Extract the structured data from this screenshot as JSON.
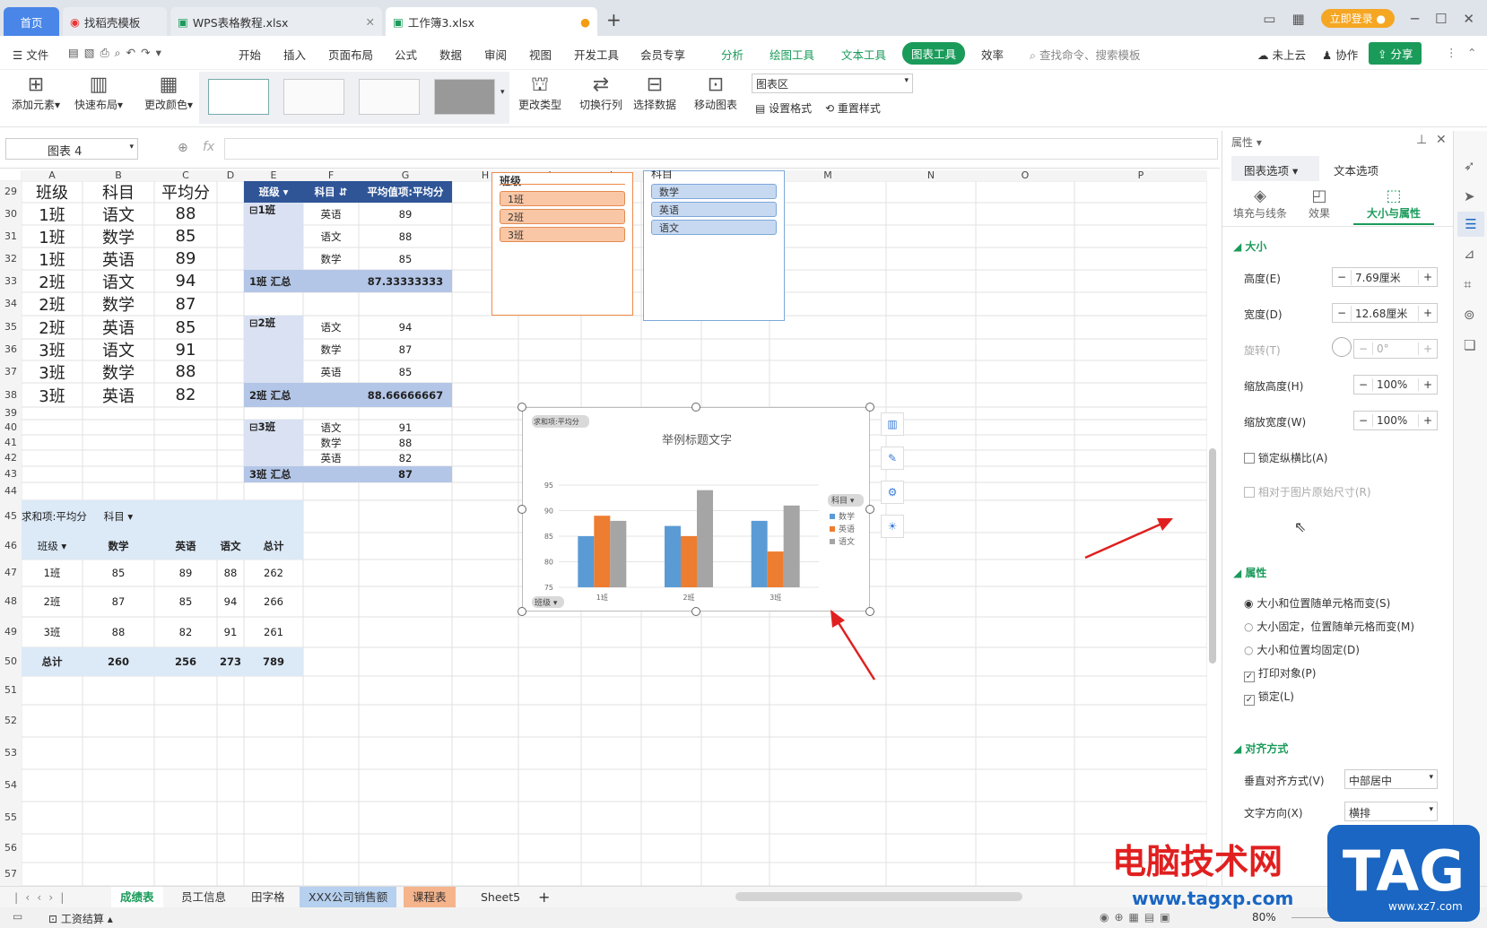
{
  "tabs": [
    {
      "label": "首页"
    },
    {
      "label": "找稻壳模板"
    },
    {
      "label": "WPS表格教程.xlsx"
    },
    {
      "label": "工作簿3.xlsx"
    }
  ],
  "login": "立即登录",
  "menu": {
    "file": "文件",
    "items": [
      "开始",
      "插入",
      "页面布局",
      "公式",
      "数据",
      "审阅",
      "视图",
      "开发工具",
      "会员专享"
    ],
    "green": [
      "分析",
      "绘图工具",
      "文本工具"
    ],
    "active": "图表工具",
    "after": "效率",
    "search": "查找命令、搜索模板",
    "cloud": "未上云",
    "collab": "协作",
    "share": "分享"
  },
  "ribbon": {
    "add": "添加元素",
    "layout": "快速布局",
    "color": "更改颜色",
    "type": "更改类型",
    "switch": "切换行列",
    "select": "选择数据",
    "move": "移动图表",
    "area": "图表区",
    "format": "设置格式",
    "reset": "重置样式"
  },
  "namebox": "图表 4",
  "fx": "fx",
  "cols": [
    "A",
    "B",
    "C",
    "D",
    "E",
    "F",
    "G",
    "H",
    "I",
    "J",
    "K",
    "L",
    "M",
    "N",
    "O",
    "P"
  ],
  "rows": [
    "29",
    "30",
    "31",
    "32",
    "33",
    "34",
    "35",
    "36",
    "37",
    "38",
    "39",
    "40",
    "41",
    "42",
    "43",
    "44",
    "45",
    "46",
    "47",
    "48",
    "49",
    "50",
    "51",
    "52",
    "53",
    "54",
    "55",
    "56",
    "57"
  ],
  "tableA": {
    "header": [
      "班级",
      "科目",
      "平均分"
    ],
    "rows": [
      [
        "1班",
        "语文",
        "88"
      ],
      [
        "1班",
        "数学",
        "85"
      ],
      [
        "1班",
        "英语",
        "89"
      ],
      [
        "2班",
        "语文",
        "94"
      ],
      [
        "2班",
        "数学",
        "87"
      ],
      [
        "2班",
        "英语",
        "85"
      ],
      [
        "3班",
        "语文",
        "91"
      ],
      [
        "3班",
        "数学",
        "88"
      ],
      [
        "3班",
        "英语",
        "82"
      ]
    ]
  },
  "pivot1": {
    "h1": "班级",
    "h2": "科目",
    "h3": "平均值项:平均分",
    "g1": "⊟1班",
    "g1rows": [
      [
        "英语",
        "89"
      ],
      [
        "语文",
        "88"
      ],
      [
        "数学",
        "85"
      ]
    ],
    "t1": "1班 汇总",
    "t1v": "87.33333333",
    "g2": "⊟2班",
    "g2rows": [
      [
        "语文",
        "94"
      ],
      [
        "数学",
        "87"
      ],
      [
        "英语",
        "85"
      ]
    ],
    "t2": "2班 汇总",
    "t2v": "88.66666667",
    "g3": "⊟3班",
    "g3rows": [
      [
        "语文",
        "91"
      ],
      [
        "数学",
        "88"
      ],
      [
        "英语",
        "82"
      ]
    ],
    "t3": "3班 汇总",
    "t3v": "87"
  },
  "pivot2": {
    "title": "求和项:平均分",
    "colfield": "科目",
    "head": [
      "班级",
      "数学",
      "英语",
      "语文",
      "总计"
    ],
    "rows": [
      [
        "1班",
        "85",
        "89",
        "88",
        "262"
      ],
      [
        "2班",
        "87",
        "85",
        "94",
        "266"
      ],
      [
        "3班",
        "88",
        "82",
        "91",
        "261"
      ]
    ],
    "total": [
      "总计",
      "260",
      "256",
      "273",
      "789"
    ]
  },
  "slicer1": {
    "title": "班级",
    "items": [
      "1班",
      "2班",
      "3班"
    ]
  },
  "slicer2": {
    "title": "科目",
    "items": [
      "数学",
      "英语",
      "语文"
    ]
  },
  "chart_data": {
    "type": "bar",
    "title": "举例标题文字",
    "field_button": "求和项:平均分",
    "legend_button": "科目",
    "axis_button": "班级",
    "categories": [
      "1班",
      "2班",
      "3班"
    ],
    "series": [
      {
        "name": "数学",
        "values": [
          85,
          87,
          88
        ],
        "color": "#5b9bd5"
      },
      {
        "name": "英语",
        "values": [
          89,
          85,
          82
        ],
        "color": "#ed7d31"
      },
      {
        "name": "语文",
        "values": [
          88,
          94,
          91
        ],
        "color": "#a5a5a5"
      }
    ],
    "ylim": [
      75,
      95
    ],
    "yticks": [
      "75",
      "80",
      "85",
      "90",
      "95"
    ],
    "legend": "right",
    "grid": true
  },
  "panel": {
    "title": "属性",
    "tab1": "图表选项",
    "tab2": "文本选项",
    "sub1": "填充与线条",
    "sub2": "效果",
    "sub3": "大小与属性",
    "size": "大小",
    "height_l": "高度(E)",
    "height_v": "7.69厘米",
    "width_l": "宽度(D)",
    "width_v": "12.68厘米",
    "rotate_l": "旋转(T)",
    "rotate_v": "0°",
    "sh_l": "缩放高度(H)",
    "sh_v": "100%",
    "sw_l": "缩放宽度(W)",
    "sw_v": "100%",
    "lock": "锁定纵横比(A)",
    "rel": "相对于图片原始尺寸(R)",
    "props": "属性",
    "r1": "大小和位置随单元格而变(S)",
    "r2": "大小固定，位置随单元格而变(M)",
    "r3": "大小和位置均固定(D)",
    "print": "打印对象(P)",
    "locked": "锁定(L)",
    "align": "对齐方式",
    "valign_l": "垂直对齐方式(V)",
    "valign_v": "中部居中",
    "dir_l": "文字方向(X)",
    "dir_v": "横排"
  },
  "sheets": [
    "成绩表",
    "员工信息",
    "田字格",
    "XXX公司销售额",
    "课程表",
    "Sheet5"
  ],
  "status": {
    "macro": "工资结算",
    "zoom": "80%"
  },
  "watermark": {
    "site": "电脑技术网",
    "url": "www.tagxp.com",
    "tag": "TAG",
    "xz": "www.xz7.com"
  }
}
